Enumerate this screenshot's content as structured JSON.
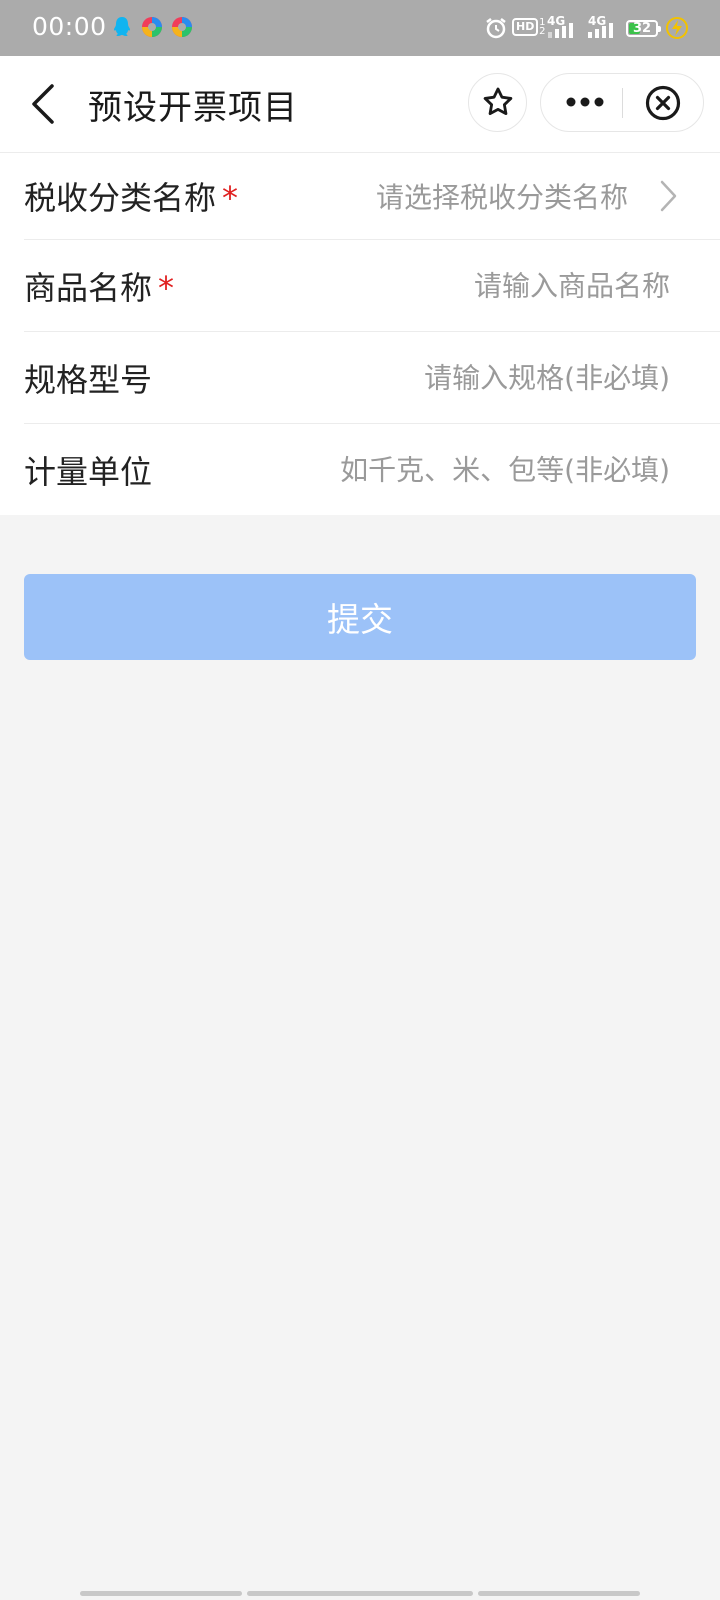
{
  "status_bar": {
    "time": "00:00",
    "network_1": "4G",
    "network_2": "4G",
    "hd_label": "HD",
    "hd_sub": "1 2",
    "battery": "32",
    "battery_color": "#3bc24a"
  },
  "nav": {
    "title": "预设开票项目",
    "back_icon": "back-arrow-icon",
    "favorite_icon": "star-icon",
    "more_icon": "more-dots-icon",
    "close_icon": "close-circle-icon"
  },
  "form": {
    "tax_category": {
      "label": "税收分类名称",
      "required_mark": "*",
      "placeholder": "请选择税收分类名称"
    },
    "product_name": {
      "label": "商品名称",
      "required_mark": "*",
      "placeholder": "请输入商品名称",
      "value": ""
    },
    "spec_model": {
      "label": "规格型号",
      "placeholder": "请输入规格(非必填)",
      "value": ""
    },
    "unit": {
      "label": "计量单位",
      "placeholder": "如千克、米、包等(非必填)",
      "value": ""
    }
  },
  "submit": {
    "label": "提交",
    "color": "#9cc2f8"
  },
  "colors": {
    "page_background": "#f4f4f4",
    "status_bar": "#ababab",
    "required": "#e02020"
  }
}
